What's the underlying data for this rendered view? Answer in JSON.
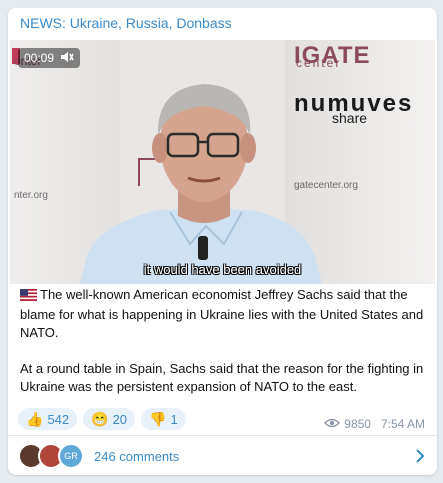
{
  "post": {
    "channel_title": "NEWS: Ukraine, Russia, Donbass",
    "video": {
      "time": "00:09",
      "subtitle": "it would have been avoided",
      "brand_name": "numuves",
      "brand_sub": "share",
      "bg_logo": "IGATE",
      "bg_logo_sub": "center",
      "wall_text_left": "nter.org",
      "wall_text_right": "gatecenter.org",
      "left_logo_fragment": "enter",
      "icons": [
        "speaker-icon"
      ]
    },
    "paragraphs": [
      "The well-known American economist Jeffrey Sachs said that the blame for what is happening in Ukraine lies with the United States and NATO.",
      "At a round table in Spain, Sachs said that the reason for the fighting in Ukraine was the persistent expansion of NATO to the east."
    ],
    "reactions": [
      {
        "emoji": "👍",
        "count": "542"
      },
      {
        "emoji": "😁",
        "count": "20"
      },
      {
        "emoji": "👎",
        "count": "1"
      }
    ],
    "views": "9850",
    "time": "7:54 AM",
    "comments_label": "246 comments",
    "avatars": [
      {
        "initials": "",
        "color": "#5a3a2c"
      },
      {
        "initials": "",
        "color": "#b0453a"
      },
      {
        "initials": "GR",
        "color": "#5fa8d8"
      }
    ]
  },
  "colors": {
    "accent": "#3a8bc9",
    "background": "#e6ebef"
  }
}
